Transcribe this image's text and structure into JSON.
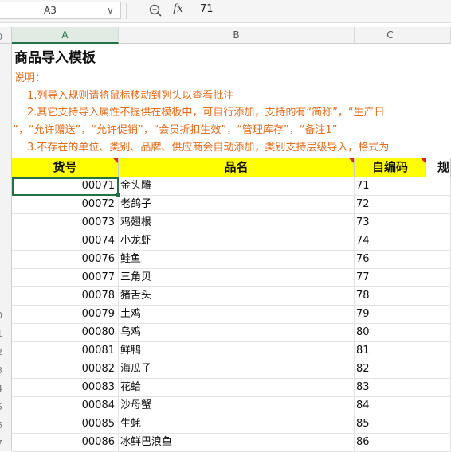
{
  "formula_bar": {
    "name_box": "A3",
    "name_box_caret": "∨",
    "zoom_icon": "zoom-out-icon",
    "fx_label": "fx",
    "formula_value": "71"
  },
  "columns": [
    {
      "id": "A",
      "label": "A",
      "active": true
    },
    {
      "id": "B",
      "label": "B",
      "active": false
    },
    {
      "id": "C",
      "label": "C",
      "active": false
    },
    {
      "id": "D",
      "label": "",
      "active": false
    }
  ],
  "row_numbers": [
    "0",
    "",
    "",
    "",
    "",
    "",
    "",
    "",
    "",
    "0",
    "1",
    "2",
    "3",
    "4",
    "5",
    "6",
    "7"
  ],
  "sheet": {
    "title": "商品导入模板",
    "notes": [
      "说明：",
      "1.列导入规则请将鼠标移动到列头以查看批注",
      "2.其它支持导入属性不提供在模板中，可自行添加，支持的有“简称”，“生产日",
      "”，“允许赠送”，“允许促销”，“会员折扣生效”，“管理库存”，“备注1”",
      "3.不存在的单位、类别、品牌、供应商会自动添加，类别支持层级导入，格式为"
    ],
    "headers": [
      "货号",
      "品名",
      "自编码",
      "规"
    ],
    "header_color": "#ffff00",
    "note_color": "#e36c1b",
    "rows": [
      {
        "code": "00071",
        "name": "金头雕",
        "self_code": "71"
      },
      {
        "code": "00072",
        "name": "老鸽子",
        "self_code": "72"
      },
      {
        "code": "00073",
        "name": "鸡翅根",
        "self_code": "73"
      },
      {
        "code": "00074",
        "name": "小龙虾",
        "self_code": "74"
      },
      {
        "code": "00076",
        "name": "鲑鱼",
        "self_code": "76"
      },
      {
        "code": "00077",
        "name": "三角贝",
        "self_code": "77"
      },
      {
        "code": "00078",
        "name": "猪舌头",
        "self_code": "78"
      },
      {
        "code": "00079",
        "name": "土鸡",
        "self_code": "79"
      },
      {
        "code": "00080",
        "name": "乌鸡",
        "self_code": "80"
      },
      {
        "code": "00081",
        "name": "鲜鸭",
        "self_code": "81"
      },
      {
        "code": "00082",
        "name": "海瓜子",
        "self_code": "82"
      },
      {
        "code": "00083",
        "name": "花蛤",
        "self_code": "83"
      },
      {
        "code": "00084",
        "name": "沙母蟹",
        "self_code": "84"
      },
      {
        "code": "00085",
        "name": "生蚝",
        "self_code": "85"
      },
      {
        "code": "00086",
        "name": "冰鲜巴浪鱼",
        "self_code": "86"
      }
    ]
  },
  "accent": "#217346"
}
